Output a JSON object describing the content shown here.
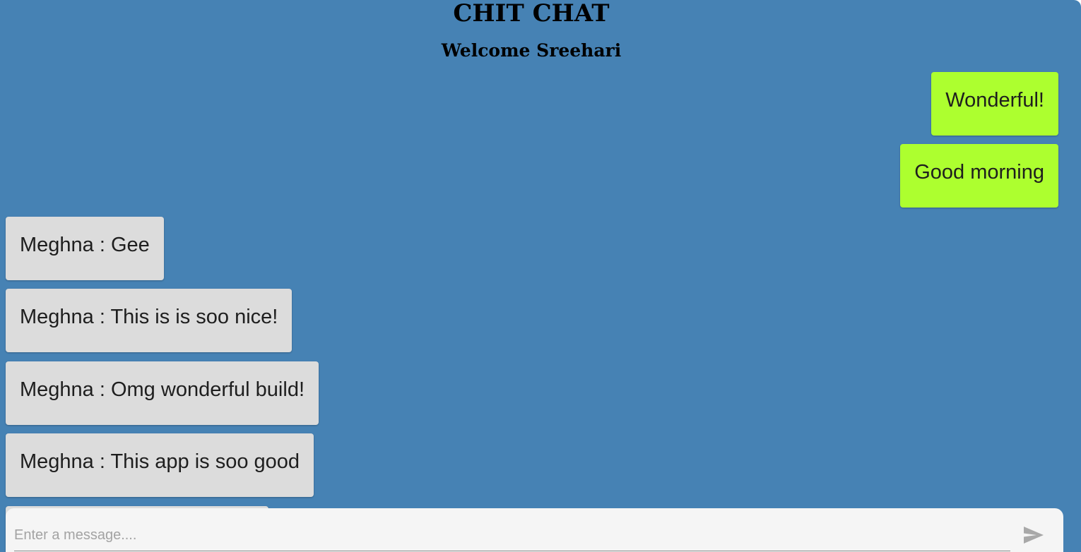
{
  "header": {
    "title": "CHIT CHAT",
    "welcome": "Welcome Sreehari"
  },
  "messages": [
    {
      "direction": "sent",
      "text": "Wonderful!"
    },
    {
      "direction": "sent",
      "text": "Good morning"
    },
    {
      "direction": "received",
      "text": "Meghna : Gee"
    },
    {
      "direction": "received",
      "text": "Meghna : This is is soo nice!"
    },
    {
      "direction": "received",
      "text": "Meghna : Omg wonderful build!"
    },
    {
      "direction": "received",
      "text": "Meghna : This app is soo good"
    },
    {
      "direction": "received",
      "text": ""
    }
  ],
  "composer": {
    "placeholder": "Enter a message....",
    "value": "",
    "send_icon": "send-icon"
  },
  "colors": {
    "background": "#4682b4",
    "sent_bubble": "#adff2f",
    "received_bubble": "#dcdcdc",
    "composer": "#f5f5f5"
  }
}
